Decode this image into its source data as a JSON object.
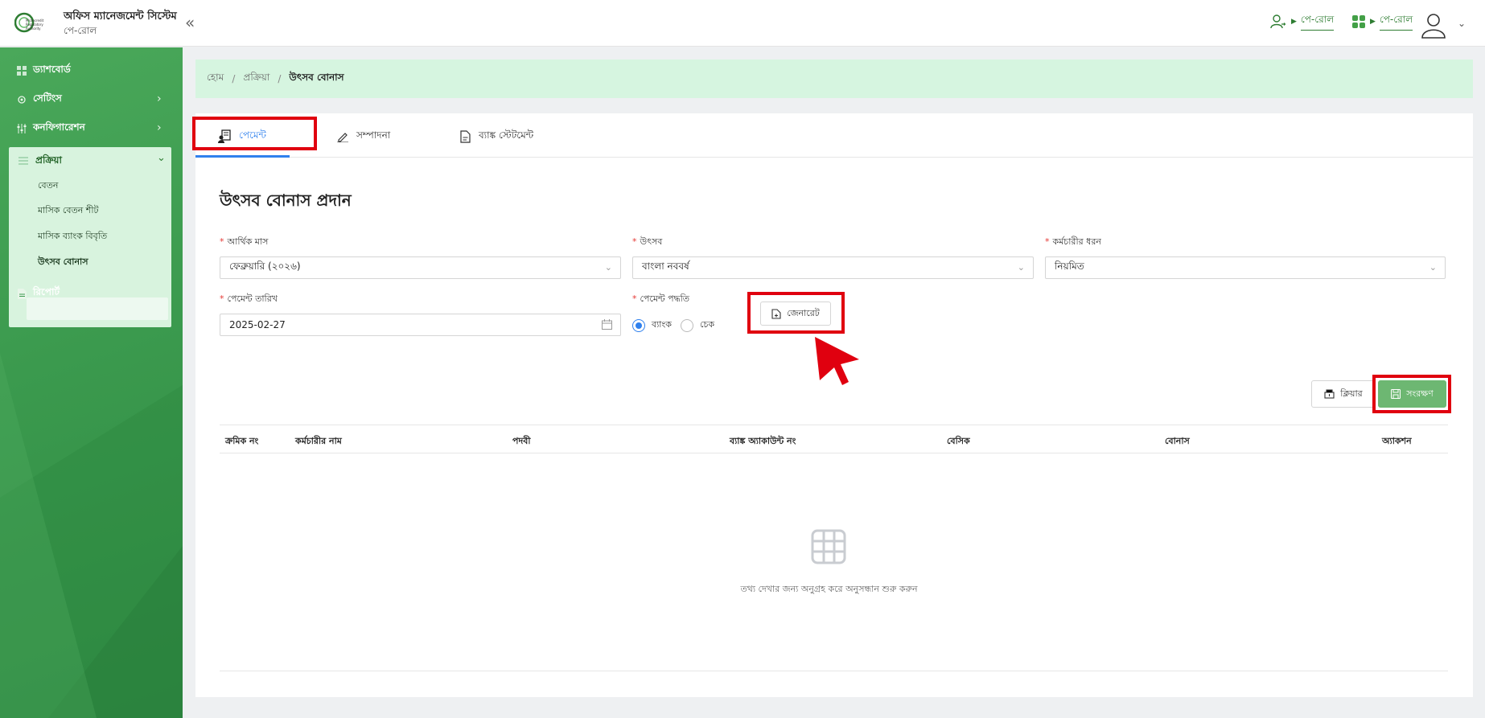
{
  "header": {
    "logo_text": "Microcredit Regulatory Authority",
    "app_title": "অফিস ম্যানেজমেন্ট সিস্টেম",
    "app_subtitle": "পে-রোল",
    "collapse_icon": "double-chevron-left-icon",
    "link1_label": "পে-রোল",
    "link2_label": "পে-রোল"
  },
  "sidebar": {
    "dashboard": "ড্যাশবোর্ড",
    "settings": "সেটিংস",
    "configuration": "কনফিগারেশন",
    "process": "প্রক্রিয়া",
    "sub_items": [
      "বেতন",
      "মাসিক বেতন শীট",
      "মাসিক ব্যাংক বিবৃতি",
      "উৎসব বোনাস"
    ],
    "report": "রিপোর্ট"
  },
  "breadcrumb": {
    "home": "হোম",
    "process": "প্রক্রিয়া",
    "current": "উৎসব বোনাস"
  },
  "tabs": {
    "payment": "পেমেন্ট",
    "edit": "সম্পাদনা",
    "bank_statement": "ব্যাঙ্ক স্টেটমেন্ট"
  },
  "form": {
    "title": "উৎসব বোনাস প্রদান",
    "fiscal_month_label": "আর্থিক মাস",
    "fiscal_month_value": "ফেব্রুয়ারি (২০২৬)",
    "festival_label": "উৎসব",
    "festival_value": "বাংলা নববর্ষ",
    "employee_type_label": "কর্মচারীর ধরন",
    "employee_type_value": "নিয়মিত",
    "payment_date_label": "পেমেন্ট তারিখ",
    "payment_date_value": "2025-02-27",
    "payment_method_label": "পেমেন্ট পদ্ধতি",
    "method_bank": "ব্যাংক",
    "method_cheque": "চেক",
    "generate_button": "জেনারেট",
    "clear_button": "ক্লিয়ার",
    "save_button": "সংরক্ষণ"
  },
  "table": {
    "columns": [
      "ক্রমিক নং",
      "কর্মচারীর নাম",
      "পদবী",
      "ব্যাঙ্ক অ্যাকাউন্ট নং",
      "বেসিক",
      "বোনাস",
      "অ্যাকশন"
    ],
    "empty_text": "তথ্য দেখার জন্য অনুগ্রহ করে অনুসন্ধান শুরু করুন"
  },
  "colors": {
    "primary_green": "#3b9a4e",
    "accent_blue": "#2f80ed",
    "highlight_red": "#e0000f",
    "save_green": "#6db772"
  }
}
